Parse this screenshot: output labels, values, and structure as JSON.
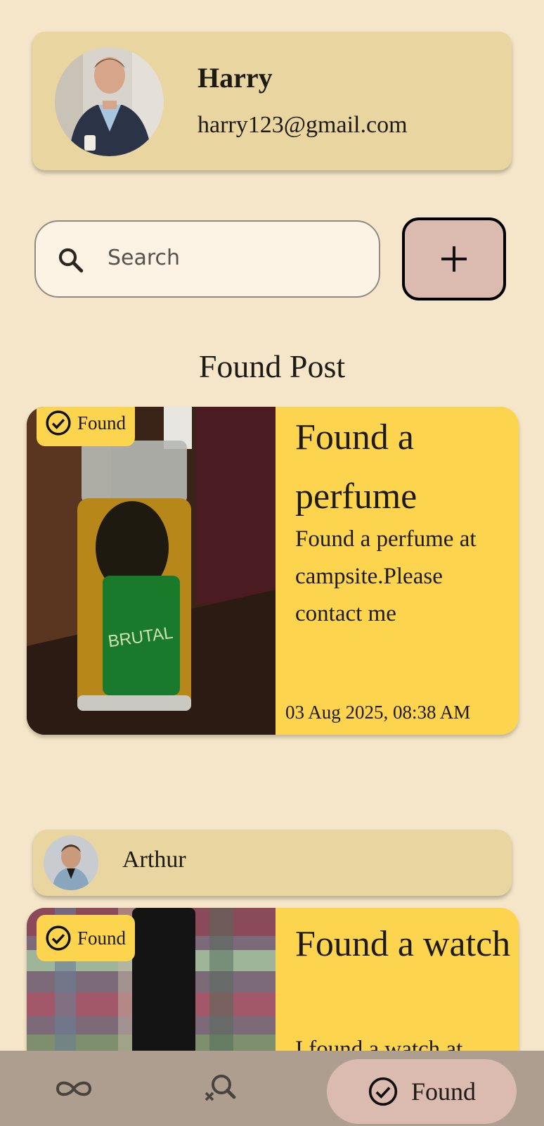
{
  "profile": {
    "name": "Harry",
    "email": "harry123@gmail.com"
  },
  "search": {
    "placeholder": "Search"
  },
  "section_title": "Found Post",
  "posts": [
    {
      "badge": "Found",
      "title": "Found a perfume",
      "description": "Found a perfume at campsite.Please contact me",
      "date": "03 Aug 2025, 08:38 AM",
      "image_label": "BRUTAL"
    },
    {
      "user": "Arthur",
      "badge": "Found",
      "title": "Found a watch",
      "description": "I found a watch at"
    }
  ],
  "nav": {
    "items": [
      {
        "icon": "infinity-icon"
      },
      {
        "icon": "search-off-icon"
      },
      {
        "icon": "check-circle-icon",
        "label": "Found",
        "active": true
      }
    ]
  },
  "colors": {
    "background": "#f6e6c9",
    "profile_card": "#e9d59f",
    "post_yellow": "#fdd44d",
    "accent_pink": "#dbbbaf",
    "nav_bar": "#ae9e8f"
  }
}
